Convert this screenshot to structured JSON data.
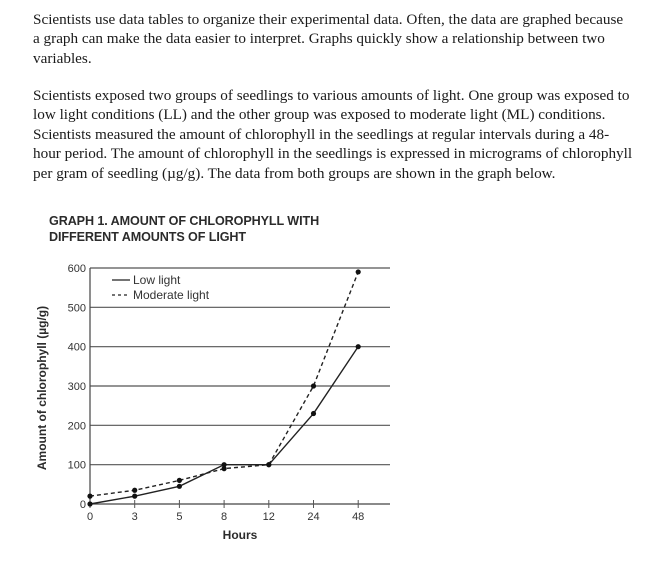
{
  "paragraphs": [
    "Scientists use data tables to organize their experimental data. Often, the data are graphed because a graph can make the data easier to interpret. Graphs quickly show a relationship between two variables.",
    "Scientists exposed two groups of seedlings to various amounts of light. One group was exposed to low light conditions (LL) and the other group was exposed to moderate light (ML) conditions. Scientists measured the amount of chlorophyll in the seedlings at regular intervals during a 48-hour period. The amount of chlorophyll in the seedlings is expressed in micrograms of chlorophyll per gram of seedling (µg/g). The data from both groups are shown in the graph below."
  ],
  "chart_data": {
    "type": "line",
    "title": "GRAPH 1. AMOUNT OF CHLOROPHYLL WITH DIFFERENT AMOUNTS OF LIGHT",
    "xlabel": "Hours",
    "ylabel": "Amount of chlorophyll (µg/g)",
    "categories": [
      "0",
      "3",
      "5",
      "8",
      "12",
      "24",
      "48"
    ],
    "yticks": [
      0,
      100,
      200,
      300,
      400,
      500,
      600
    ],
    "ylim": [
      0,
      600
    ],
    "grid": "horizontal",
    "legend_position": "top-left",
    "series": [
      {
        "name": "Low light",
        "style": "solid",
        "values": [
          0,
          20,
          45,
          100,
          100,
          230,
          400
        ]
      },
      {
        "name": "Moderate light",
        "style": "dashed",
        "values": [
          20,
          35,
          60,
          90,
          100,
          300,
          590
        ]
      }
    ]
  }
}
